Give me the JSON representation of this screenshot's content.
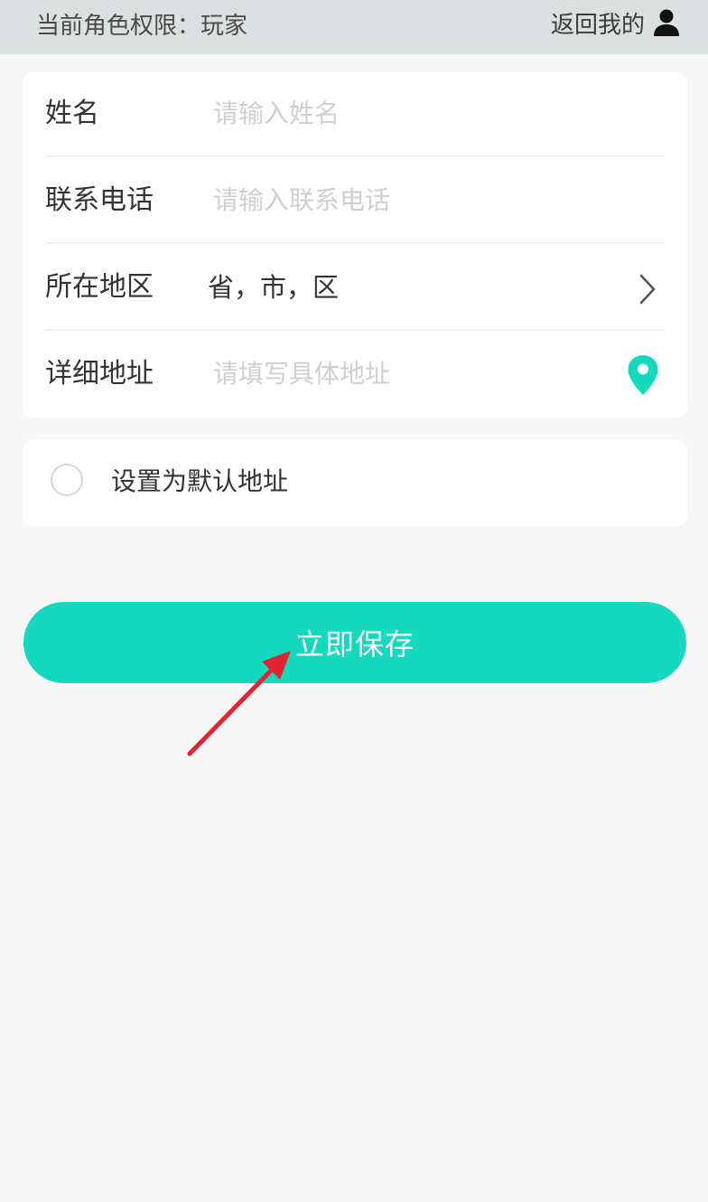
{
  "header": {
    "role_text": "当前角色权限：玩家",
    "back_label": "返回我的"
  },
  "form": {
    "name": {
      "label": "姓名",
      "placeholder": "请输入姓名",
      "value": ""
    },
    "phone": {
      "label": "联系电话",
      "placeholder": "请输入联系电话",
      "value": ""
    },
    "region": {
      "label": "所在地区",
      "value": "省，市，区"
    },
    "detail": {
      "label": "详细地址",
      "placeholder": "请填写具体地址",
      "value": ""
    }
  },
  "default_option": {
    "label": "设置为默认地址",
    "checked": false
  },
  "save_button": {
    "label": "立即保存"
  },
  "colors": {
    "accent": "#14d9be",
    "annotation_arrow": "#e02530",
    "header_bg": "#dcdfe0",
    "page_bg": "#f7f7f8"
  },
  "icons": {
    "user": "user-icon",
    "chevron": "chevron-right-icon",
    "location": "location-pin-icon"
  }
}
